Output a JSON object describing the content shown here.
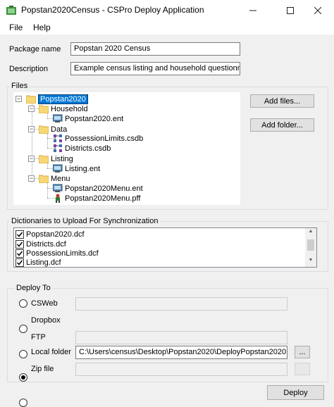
{
  "window": {
    "title": "Popstan2020Census - CSPro Deploy Application",
    "minimize_glyph": "─",
    "maximize_glyph": "☐",
    "close_glyph": "✕"
  },
  "menu": {
    "file": "File",
    "help": "Help"
  },
  "package_name": {
    "label": "Package name",
    "value": "Popstan 2020 Census"
  },
  "description": {
    "label": "Description",
    "value": "Example census listing and household questionnaires from"
  },
  "files": {
    "title": "Files",
    "add_files": "Add files...",
    "add_folder": "Add folder...",
    "root": "Popstan2020",
    "folders": [
      {
        "name": "Household",
        "items": [
          "Popstan2020.ent"
        ]
      },
      {
        "name": "Data",
        "items": [
          "PossessionLimits.csdb",
          "Districts.csdb"
        ]
      },
      {
        "name": "Listing",
        "items": [
          "Listing.ent"
        ]
      },
      {
        "name": "Menu",
        "items": [
          "Popstan2020Menu.ent",
          "Popstan2020Menu.pff"
        ]
      }
    ],
    "expander_glyph": "−"
  },
  "dictionaries": {
    "title": "Dictionaries to Upload For Synchronization",
    "items": [
      {
        "label": "Popstan2020.dcf",
        "checked": true
      },
      {
        "label": "Districts.dcf",
        "checked": true
      },
      {
        "label": "PossessionLimits.dcf",
        "checked": true
      },
      {
        "label": "Listing.dcf",
        "checked": true
      }
    ],
    "scroll_up_glyph": "▲",
    "scroll_down_glyph": "▼"
  },
  "deploy_to": {
    "title": "Deploy To",
    "options": [
      {
        "label": "CSWeb",
        "selected": false,
        "value": ""
      },
      {
        "label": "Dropbox",
        "selected": false
      },
      {
        "label": "FTP",
        "selected": false,
        "value": ""
      },
      {
        "label": "Local folder",
        "selected": true,
        "value": "C:\\Users\\census\\Desktop\\Popstan2020\\DeployPopstan2020"
      },
      {
        "label": "Zip file",
        "selected": false,
        "value": ""
      }
    ],
    "browse_label": "..."
  },
  "deploy_button": "Deploy",
  "colors": {
    "selection": "#0078d7",
    "folder": "#f8d775"
  }
}
